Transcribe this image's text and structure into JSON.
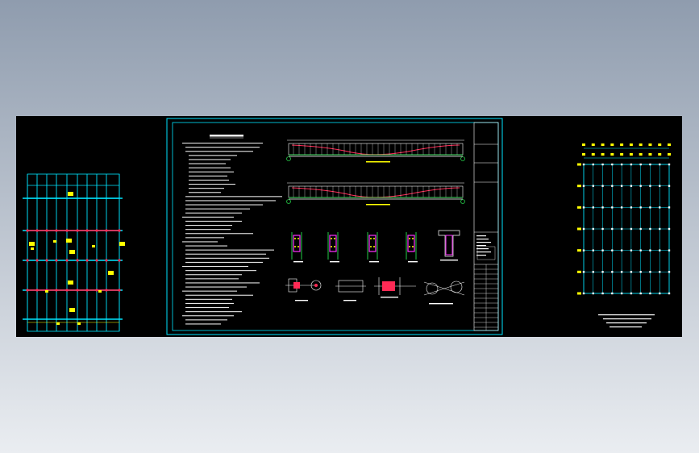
{
  "viewport": {
    "background_top": "#93a0b1",
    "background_bottom": "#e6e9ee",
    "canvas": "#000000"
  },
  "colors": {
    "frame": "#00e5ff",
    "beam": "#ff2a55",
    "note": "#ffff00",
    "text": "#ffffff",
    "green": "#2fff5a",
    "magenta": "#ff33ff"
  },
  "sheets": {
    "left": {
      "name": "beam-layout-plan-left",
      "bay_count": 12
    },
    "center": {
      "name": "construction-notes-sheet",
      "title": "",
      "elevations": 2,
      "section_details": 5,
      "node_details": 4
    },
    "right": {
      "name": "column-grid-plan-right",
      "grid_cols": 9,
      "grid_rows": 6
    }
  }
}
